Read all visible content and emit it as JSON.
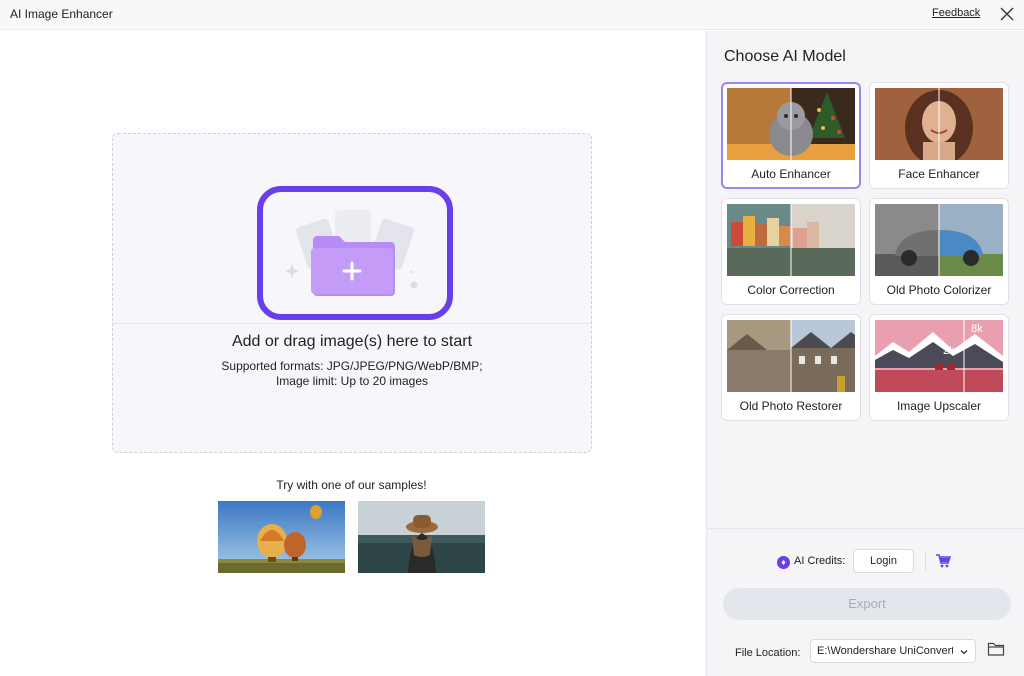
{
  "window": {
    "title": "AI Image Enhancer",
    "feedback_label": "Feedback",
    "close_icon": "close-icon"
  },
  "dropzone": {
    "main_text": "Add or drag image(s) here to start",
    "formats_text": "Supported formats: JPG/JPEG/PNG/WebP/BMP;",
    "limit_text": "Image limit: Up to 20 images",
    "icon": "folder-add-icon",
    "highlight_color": "#6a3ee8"
  },
  "samples": {
    "label": "Try with one of our samples!",
    "items": [
      "hot-air-balloons-sample",
      "woman-hat-sample"
    ]
  },
  "models": {
    "title": "Choose AI Model",
    "selected": "Auto Enhancer",
    "items": [
      {
        "label": "Auto Enhancer",
        "selected": true
      },
      {
        "label": "Face Enhancer",
        "selected": false
      },
      {
        "label": "Color Correction",
        "selected": false
      },
      {
        "label": "Old Photo Colorizer",
        "selected": false
      },
      {
        "label": "Old Photo Restorer",
        "selected": false
      },
      {
        "label": "Image Upscaler",
        "selected": false
      }
    ],
    "upscaler_badges": [
      "8k",
      "2k"
    ]
  },
  "account": {
    "credits_label": "AI Credits:",
    "login_label": "Login",
    "cart_icon": "cart-icon"
  },
  "export": {
    "button_label": "Export",
    "file_location_label": "File Location:",
    "file_location_value": "E:\\Wondershare UniConverter",
    "folder_icon": "folder-icon"
  },
  "colors": {
    "accent": "#6a3ee8",
    "accent_light": "#9b85f0",
    "export_disabled_bg": "#e4e6ee"
  }
}
